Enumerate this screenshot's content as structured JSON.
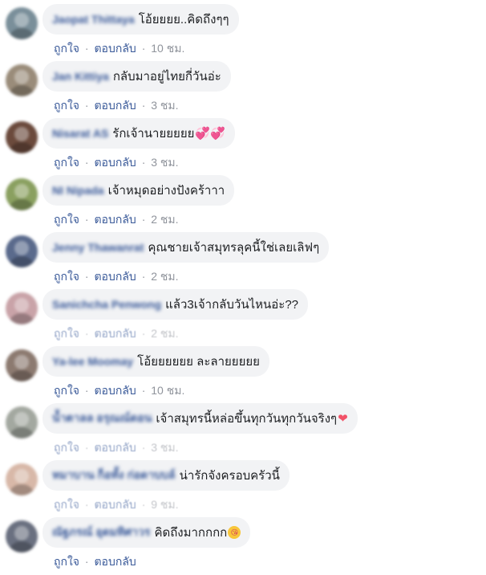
{
  "labels": {
    "like": "ถูกใจ",
    "reply": "ตอบกลับ",
    "sep": "·"
  },
  "comments": [
    {
      "author": "Jaopat Thittaya",
      "text": "โอ้ยยยย..คิดถึงๆๆ",
      "emoji": "",
      "time": "10 ชม.",
      "avatar_color": "#7a8f9a"
    },
    {
      "author": "Jan Kittiya",
      "text": "กลับมาอยู่ไทยกี่วันอ่ะ",
      "emoji": "",
      "time": "3 ชม.",
      "avatar_color": "#9a8c7a"
    },
    {
      "author": "Nisarat AS",
      "text": "รักเจ้านายยยยย",
      "emoji": "💞💞",
      "time": "3 ชม.",
      "avatar_color": "#6b4a3c"
    },
    {
      "author": "NI Nipada",
      "text": "เจ้าหมุดอย่างปังคร้าาา",
      "emoji": "",
      "time": "2 ชม.",
      "avatar_color": "#8aa060"
    },
    {
      "author": "Jenny Thawanrat",
      "text": "คุณชายเจ้าสมุทรลุคนี้ใช่เลยเลิฟๆ",
      "emoji": "",
      "time": "2 ชม.",
      "avatar_color": "#5a6a8c"
    },
    {
      "author": "Sanichcha Penwong",
      "text": "แล้ว3เจ้ากลับวันไหนอ่ะ??",
      "emoji": "",
      "time": "2 ชม.",
      "avatar_color": "#c9a3a8"
    },
    {
      "author": "Ya-lee Moomay",
      "text": "โอ้ยยยยยย ละลายยยยย",
      "emoji": "",
      "time": "10 ชม.",
      "avatar_color": "#8c7a70"
    },
    {
      "author": "น้ำตาลล อรุณณ์ดอน",
      "text": "เจ้าสมุทรนี้หล่อขึ้นทุกวันทุกวันจริงๆ",
      "emoji": "❤",
      "time": "3 ชม.",
      "avatar_color": "#a3a8a0"
    },
    {
      "author": "หมาบาน ก็อทั้ง ก่อดาบบล์",
      "text": "น่ารักจังครอบครัวนี้",
      "emoji": "",
      "time": "9 ชม.",
      "avatar_color": "#d8b8a8"
    },
    {
      "author": "ณัฐภรณ์ อุดมทิศาวร",
      "text": "คิดถึงมากกกก",
      "emoji": "😘",
      "time": "",
      "avatar_color": "#6a7080"
    }
  ]
}
